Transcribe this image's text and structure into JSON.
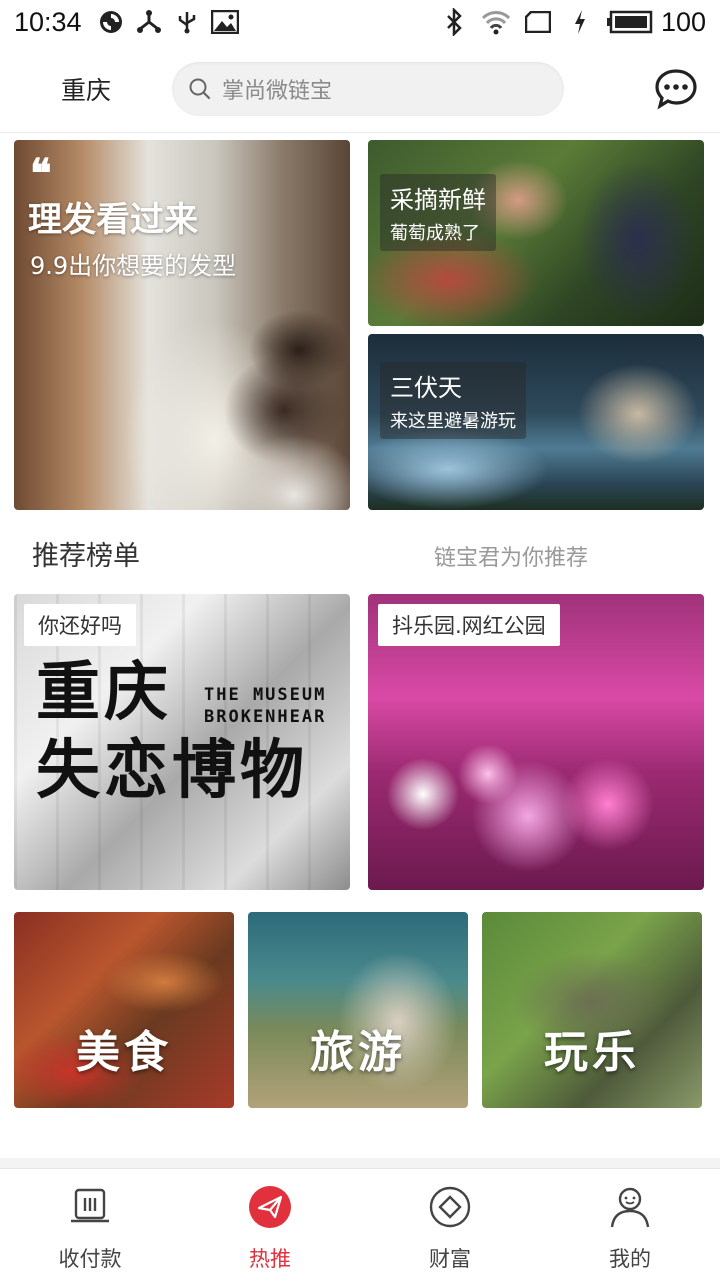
{
  "status_bar": {
    "time": "10:34",
    "battery_level": "100",
    "icons": [
      "sync-icon",
      "share-icon",
      "usb-icon",
      "image-icon",
      "bluetooth-icon",
      "wifi-icon",
      "sim-icon",
      "charging-icon",
      "battery-icon"
    ]
  },
  "header": {
    "city": "重庆",
    "search_placeholder": "掌尚微链宝",
    "message_icon": "chat-bubble-icon"
  },
  "promos": {
    "haircut": {
      "title": "理发看过来",
      "subtitle": "9.9出你想要的发型",
      "quote": "❝"
    },
    "grapes": {
      "title": "采摘新鲜",
      "subtitle": "葡萄成熟了"
    },
    "summer": {
      "title": "三伏天",
      "subtitle": "来这里避暑游玩"
    }
  },
  "recommend": {
    "title": "推荐榜单",
    "subtitle": "链宝君为你推荐",
    "cards": [
      {
        "tag": "你还好吗",
        "art_text_line1": "重庆",
        "art_text_line2": "失恋博物",
        "art_en_line1": "THE MUSEUM",
        "art_en_line2": "BROKENHEAR"
      },
      {
        "tag": "抖乐园.网红公园"
      }
    ]
  },
  "categories": [
    {
      "label": "美食"
    },
    {
      "label": "旅游"
    },
    {
      "label": "玩乐"
    }
  ],
  "bottom_nav": [
    {
      "label": "收付款",
      "icon": "pos-terminal-icon",
      "active": false
    },
    {
      "label": "热推",
      "icon": "paper-plane-icon",
      "active": true
    },
    {
      "label": "财富",
      "icon": "diamond-icon",
      "active": false
    },
    {
      "label": "我的",
      "icon": "user-icon",
      "active": false
    }
  ],
  "colors": {
    "accent": "#e0313c",
    "muted": "#999999"
  }
}
